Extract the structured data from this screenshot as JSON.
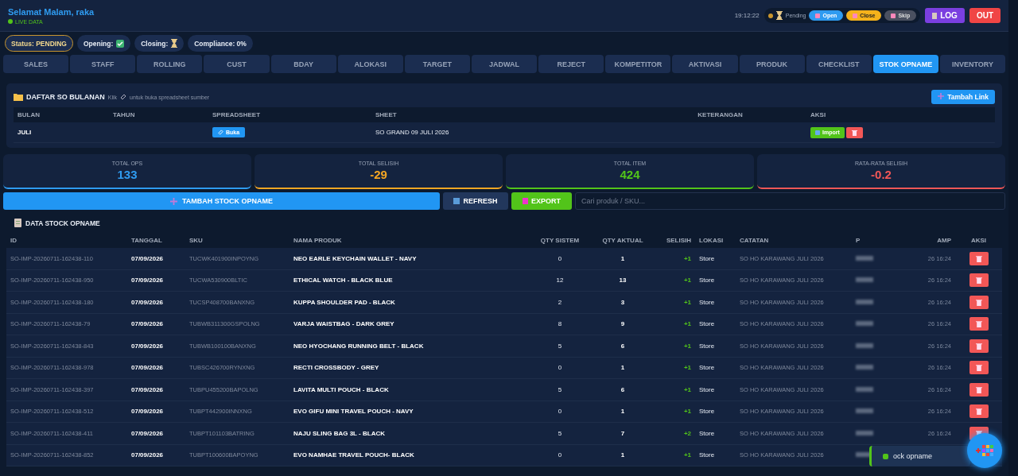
{
  "header": {
    "greeting": "Selamat Malam, raka",
    "live_label": "LIVE DATA",
    "time": "19:12:22",
    "shift_state": "Pending",
    "shift_buttons": [
      {
        "label": "Open",
        "kind": "open"
      },
      {
        "label": "Close",
        "kind": "close"
      },
      {
        "label": "Skip",
        "kind": "skip"
      }
    ],
    "log_button": "LOG",
    "out_button": "OUT"
  },
  "status_pills": [
    {
      "label": "Status: PENDING",
      "kind": "warning"
    },
    {
      "label": "Opening:",
      "kind": "check"
    },
    {
      "label": "Closing:",
      "kind": "hourglass"
    },
    {
      "label": "Compliance: 0%",
      "kind": "plain"
    }
  ],
  "tabs": [
    {
      "label": "SALES",
      "selected": false
    },
    {
      "label": "STAFF",
      "selected": false
    },
    {
      "label": "ROLLING",
      "selected": false
    },
    {
      "label": "CUST",
      "selected": false
    },
    {
      "label": "BDAY",
      "selected": false
    },
    {
      "label": "ALOKASI",
      "selected": false
    },
    {
      "label": "TARGET",
      "selected": false
    },
    {
      "label": "JADWAL",
      "selected": false
    },
    {
      "label": "REJECT",
      "selected": false
    },
    {
      "label": "KOMPETITOR",
      "selected": false
    },
    {
      "label": "AKTIVASI",
      "selected": false
    },
    {
      "label": "PRODUK",
      "selected": false
    },
    {
      "label": "CHECKLIST",
      "selected": false
    },
    {
      "label": "STOK OPNAME",
      "selected": true
    },
    {
      "label": "INVENTORY",
      "selected": false
    }
  ],
  "so_panel": {
    "title": "DAFTAR SO BULANAN",
    "hint_before": "Klik",
    "hint_after": "untuk buka spreadsheet sumber",
    "add_button": "Tambah Link",
    "columns": [
      "BULAN",
      "TAHUN",
      "SPREADSHEET",
      "SHEET",
      "KETERANGAN",
      "AKSI"
    ],
    "rows": [
      {
        "bulan": "JULI",
        "open_button": "Buka",
        "sheet": "SO GRAND 09 JULI 2026",
        "import_button": "Import"
      }
    ]
  },
  "stats": [
    {
      "label": "TOTAL OPS",
      "value": "133",
      "color": "#2f9bf0"
    },
    {
      "label": "TOTAL SELISIH",
      "value": "-29",
      "color": "#f5a623"
    },
    {
      "label": "TOTAL ITEM",
      "value": "424",
      "color": "#52c41a"
    },
    {
      "label": "RATA-RATA SELISIH",
      "value": "-0.2",
      "color": "#f25757"
    }
  ],
  "actions": {
    "add_button": "TAMBAH STOCK OPNAME",
    "refresh_button": "REFRESH",
    "export_button": "EXPORT",
    "search": {
      "placeholder": "Cari produk / SKU..."
    }
  },
  "table": {
    "title": "DATA STOCK OPNAME",
    "columns": [
      "ID",
      "TANGGAL",
      "SKU",
      "NAMA PRODUK",
      "QTY SISTEM",
      "QTY AKTUAL",
      "SELISIH",
      "LOKASI",
      "CATATAN",
      "P",
      "AMP",
      "AKSI"
    ],
    "rows": [
      {
        "id": "SO-IMP-20260711-162438-110",
        "tanggal": "07/09/2026",
        "sku": "TUCWK401900INPOYNG",
        "nama": "NEO EARLE KEYCHAIN WALLET - NAVY",
        "qty_sistem": "0",
        "qty_aktual": "1",
        "selisih": "+1",
        "lokasi": "Store",
        "catatan": "SO HO KARAWANG JULI 2026",
        "column_11": "26 16:24"
      },
      {
        "id": "SO-IMP-20260711-162438-950",
        "tanggal": "07/09/2026",
        "sku": "TUCWA530900BLTIC",
        "nama": "ETHICAL WATCH - BLACK BLUE",
        "qty_sistem": "12",
        "qty_aktual": "13",
        "selisih": "+1",
        "lokasi": "Store",
        "catatan": "SO HO KARAWANG JULI 2026",
        "column_11": "26 16:24"
      },
      {
        "id": "SO-IMP-20260711-162438-180",
        "tanggal": "07/09/2026",
        "sku": "TUCSP408700BANXNG",
        "nama": "KUPPA SHOULDER PAD - BLACK",
        "qty_sistem": "2",
        "qty_aktual": "3",
        "selisih": "+1",
        "lokasi": "Store",
        "catatan": "SO HO KARAWANG JULI 2026",
        "column_11": "26 16:24"
      },
      {
        "id": "SO-IMP-20260711-162438-79",
        "tanggal": "07/09/2026",
        "sku": "TUBWB311300GSPOLNG",
        "nama": "VARJA WAISTBAG - DARK GREY",
        "qty_sistem": "8",
        "qty_aktual": "9",
        "selisih": "+1",
        "lokasi": "Store",
        "catatan": "SO HO KARAWANG JULI 2026",
        "column_11": "26 16:24"
      },
      {
        "id": "SO-IMP-20260711-162438-843",
        "tanggal": "07/09/2026",
        "sku": "TUBWB100100BANXNG",
        "nama": "NEO HYOCHANG RUNNING BELT - BLACK",
        "qty_sistem": "5",
        "qty_aktual": "6",
        "selisih": "+1",
        "lokasi": "Store",
        "catatan": "SO HO KARAWANG JULI 2026",
        "column_11": "26 16:24"
      },
      {
        "id": "SO-IMP-20260711-162438-978",
        "tanggal": "07/09/2026",
        "sku": "TUBSC426700RYNXNG",
        "nama": "RECTI CROSSBODY - GREY",
        "qty_sistem": "0",
        "qty_aktual": "1",
        "selisih": "+1",
        "lokasi": "Store",
        "catatan": "SO HO KARAWANG JULI 2026",
        "column_11": "26 16:24"
      },
      {
        "id": "SO-IMP-20260711-162438-397",
        "tanggal": "07/09/2026",
        "sku": "TUBPU455200BAPOLNG",
        "nama": "LAVITA MULTI POUCH - BLACK",
        "qty_sistem": "5",
        "qty_aktual": "6",
        "selisih": "+1",
        "lokasi": "Store",
        "catatan": "SO HO KARAWANG JULI 2026",
        "column_11": "26 16:24"
      },
      {
        "id": "SO-IMP-20260711-162438-512",
        "tanggal": "07/09/2026",
        "sku": "TUBPT442900INNXNG",
        "nama": "EVO GIFU MINI TRAVEL POUCH - NAVY",
        "qty_sistem": "0",
        "qty_aktual": "1",
        "selisih": "+1",
        "lokasi": "Store",
        "catatan": "SO HO KARAWANG JULI 2026",
        "column_11": "26 16:24"
      },
      {
        "id": "SO-IMP-20260711-162438-411",
        "tanggal": "07/09/2026",
        "sku": "TUBPT101103BATRING",
        "nama": "NAJU SLING BAG 3L - BLACK",
        "qty_sistem": "5",
        "qty_aktual": "7",
        "selisih": "+2",
        "lokasi": "Store",
        "catatan": "SO HO KARAWANG JULI 2026",
        "column_11": "26 16:24"
      },
      {
        "id": "SO-IMP-20260711-162438-852",
        "tanggal": "07/09/2026",
        "sku": "TUBPT100600BAPOYNG",
        "nama": "EVO NAMHAE TRAVEL POUCH- BLACK",
        "qty_sistem": "0",
        "qty_aktual": "1",
        "selisih": "+1",
        "lokasi": "Store",
        "catatan": "SO HO KARAWANG JULI 2026"
      }
    ]
  },
  "toast": {
    "text": "ock opname"
  }
}
